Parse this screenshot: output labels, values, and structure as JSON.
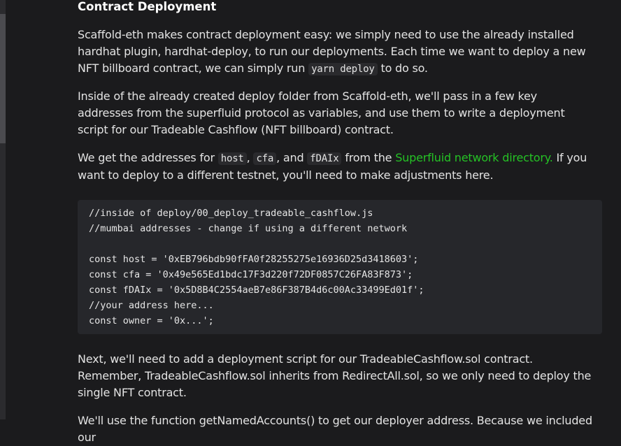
{
  "section": {
    "heading": "Contract Deployment"
  },
  "p1": {
    "text_a": "Scaffold-eth makes contract deployment easy: we simply need to use the already installed hardhat plugin, hardhat-deploy, to run our deployments. Each time we want to deploy a new NFT billboard contract, we can simply run ",
    "code": "yarn deploy",
    "text_b": " to do so."
  },
  "p2": {
    "text": "Inside of the already created deploy folder from Scaffold-eth, we'll pass in a few key addresses from the superfluid protocol as variables, and use them to write a deployment script for our Tradeable Cashflow (NFT billboard) contract."
  },
  "p3": {
    "text_a": "We get the addresses for ",
    "code_host": "host",
    "sep1": ", ",
    "code_cfa": "cfa",
    "sep2": ", and ",
    "code_fdaix": "fDAIx",
    "text_b": " from the ",
    "link": "Superfluid network directory.",
    "text_c": " If you want to deploy to a different testnet, you'll need to make adjustments here."
  },
  "code_block": {
    "lines": [
      "//inside of deploy/00_deploy_tradeable_cashflow.js",
      "//mumbai addresses - change if using a different network",
      "",
      "const host = '0xEB796bdb90fFA0f28255275e16936D25d3418603';",
      "const cfa = '0x49e565Ed1bdc17F3d220f72DF0857C26FA83F873';",
      "const fDAIx = '0x5D8B4C2554aeB7e86F387B4d6c00Ac33499Ed01f';",
      "//your address here...",
      "const owner = '0x...';"
    ]
  },
  "p4": {
    "text": "Next, we'll need to add a deployment script for our TradeableCashflow.sol contract. Remember, TradeableCashflow.sol inherits from RedirectAll.sol, so we only need to deploy the single NFT contract."
  },
  "p5": {
    "text": "We'll use the function getNamedAccounts() to get our deployer address. Because we included our"
  },
  "colors": {
    "background": "#1b1b1d",
    "text": "#e3e3e3",
    "link": "#25c225",
    "code_bg": "#26272b"
  }
}
